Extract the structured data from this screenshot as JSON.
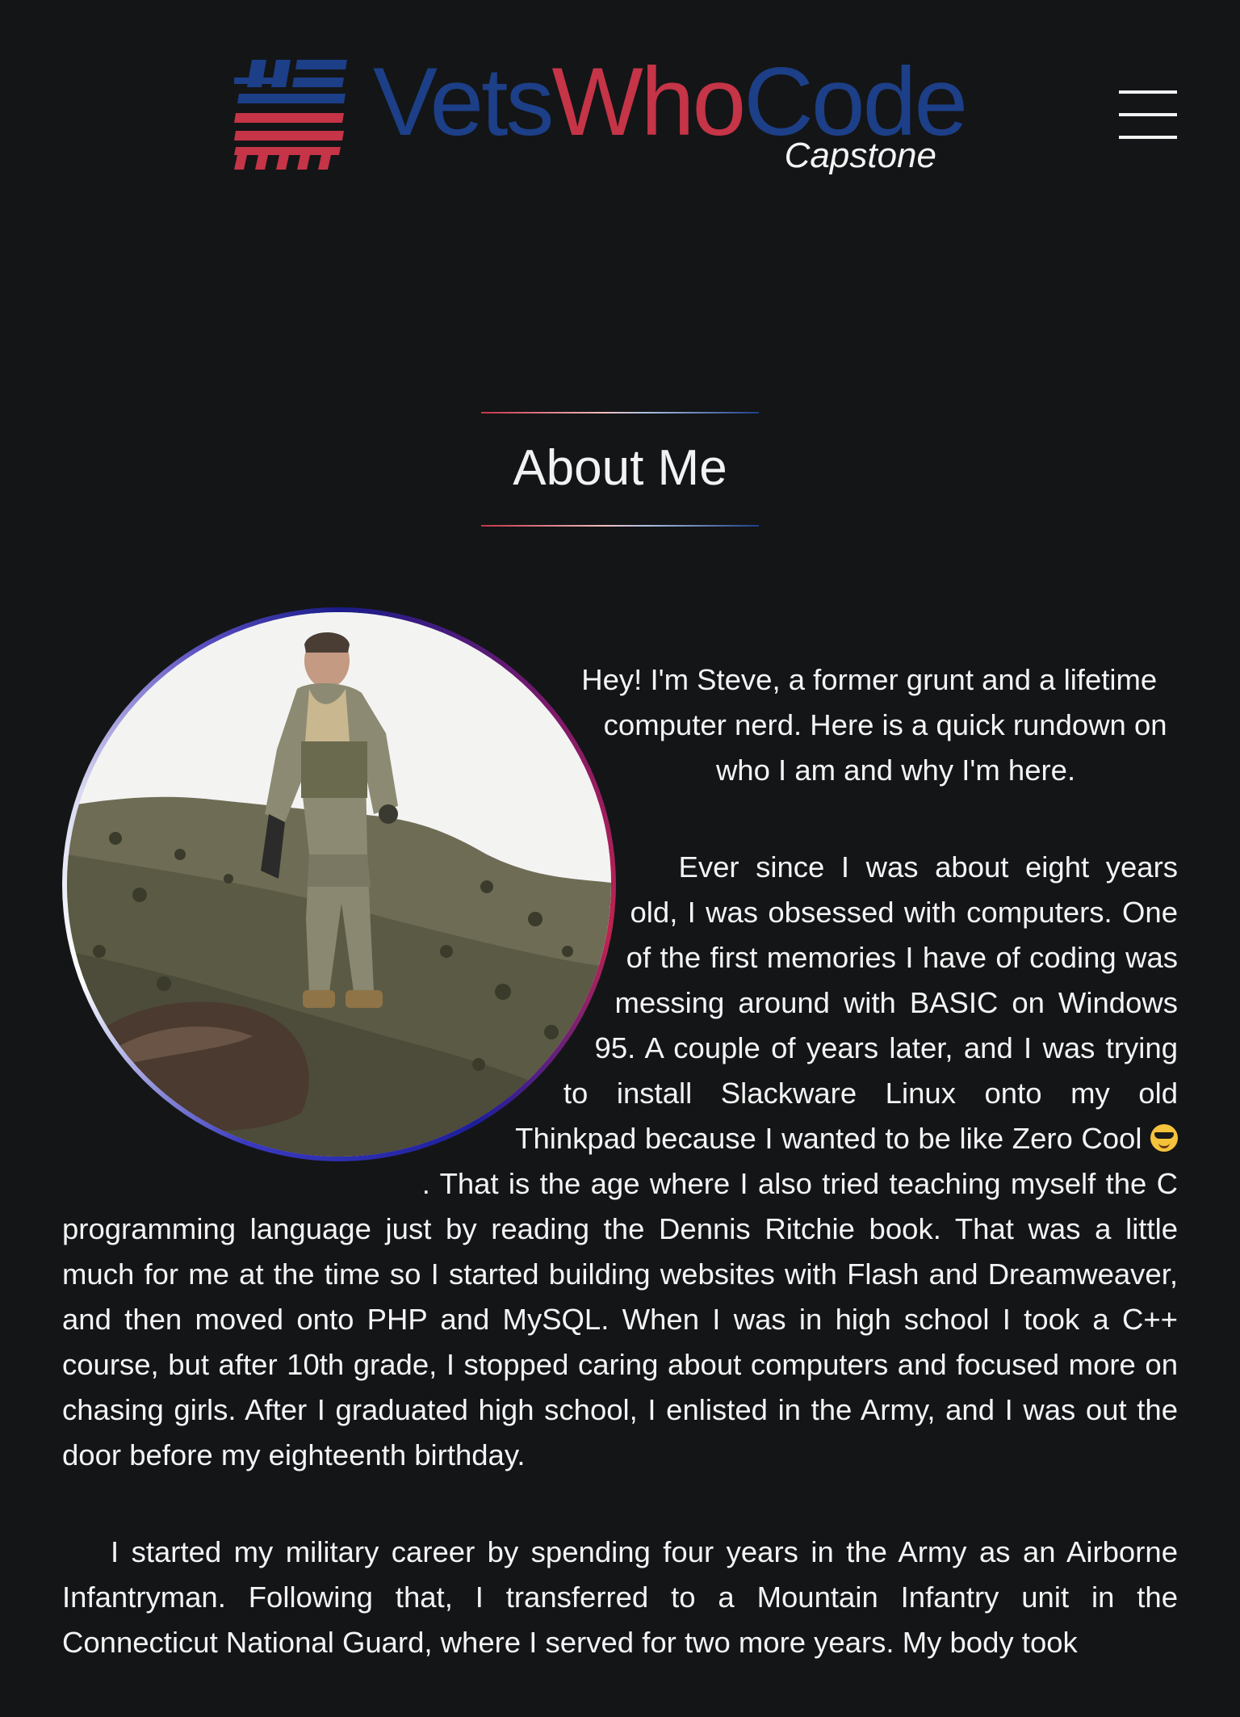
{
  "header": {
    "logo_part1": "Vets",
    "logo_part2": "Who",
    "logo_part3": "Code",
    "logo_subtitle": "Capstone",
    "logo_icon": "flag-hash-icon",
    "menu_icon": "hamburger-menu-icon"
  },
  "colors": {
    "background": "#141517",
    "brand_blue": "#1c3f87",
    "brand_red": "#c53447",
    "text": "#f2f2f2"
  },
  "about": {
    "title": "About Me",
    "portrait_alt": "Soldier in camouflage gear on a hillside",
    "intro": "Hey! I'm Steve, a former grunt and a lifetime computer nerd. Here is a quick rundown on who I am and why I'm here.",
    "para2_before_emoji": "Ever since I was about eight years old, I was obsessed with computers. One of the first memories I have of coding was messing around with BASIC on Windows 95. A couple of years later, and I was trying to install Slackware Linux onto my old Thinkpad because I wanted to be like Zero Cool",
    "emoji_icon": "sunglasses-emoji-icon",
    "para2_after_emoji": ". That is the age where I also tried teaching myself the C programming language just by reading the Dennis Ritchie book. That was a little much for me at the time so I started building websites with Flash and Dreamweaver, and then moved onto PHP and MySQL. When I was in high school I took a C++ course, but after 10th grade, I stopped caring about computers and focused more on chasing girls. After I graduated high school, I enlisted in the Army, and I was out the door before my eighteenth birthday.",
    "para3": "I started my military career by spending four years in the Army as an Airborne Infantryman. Following that, I transferred to a Mountain Infantry unit in the Connecticut National Guard, where I served for two more years. My body took"
  }
}
